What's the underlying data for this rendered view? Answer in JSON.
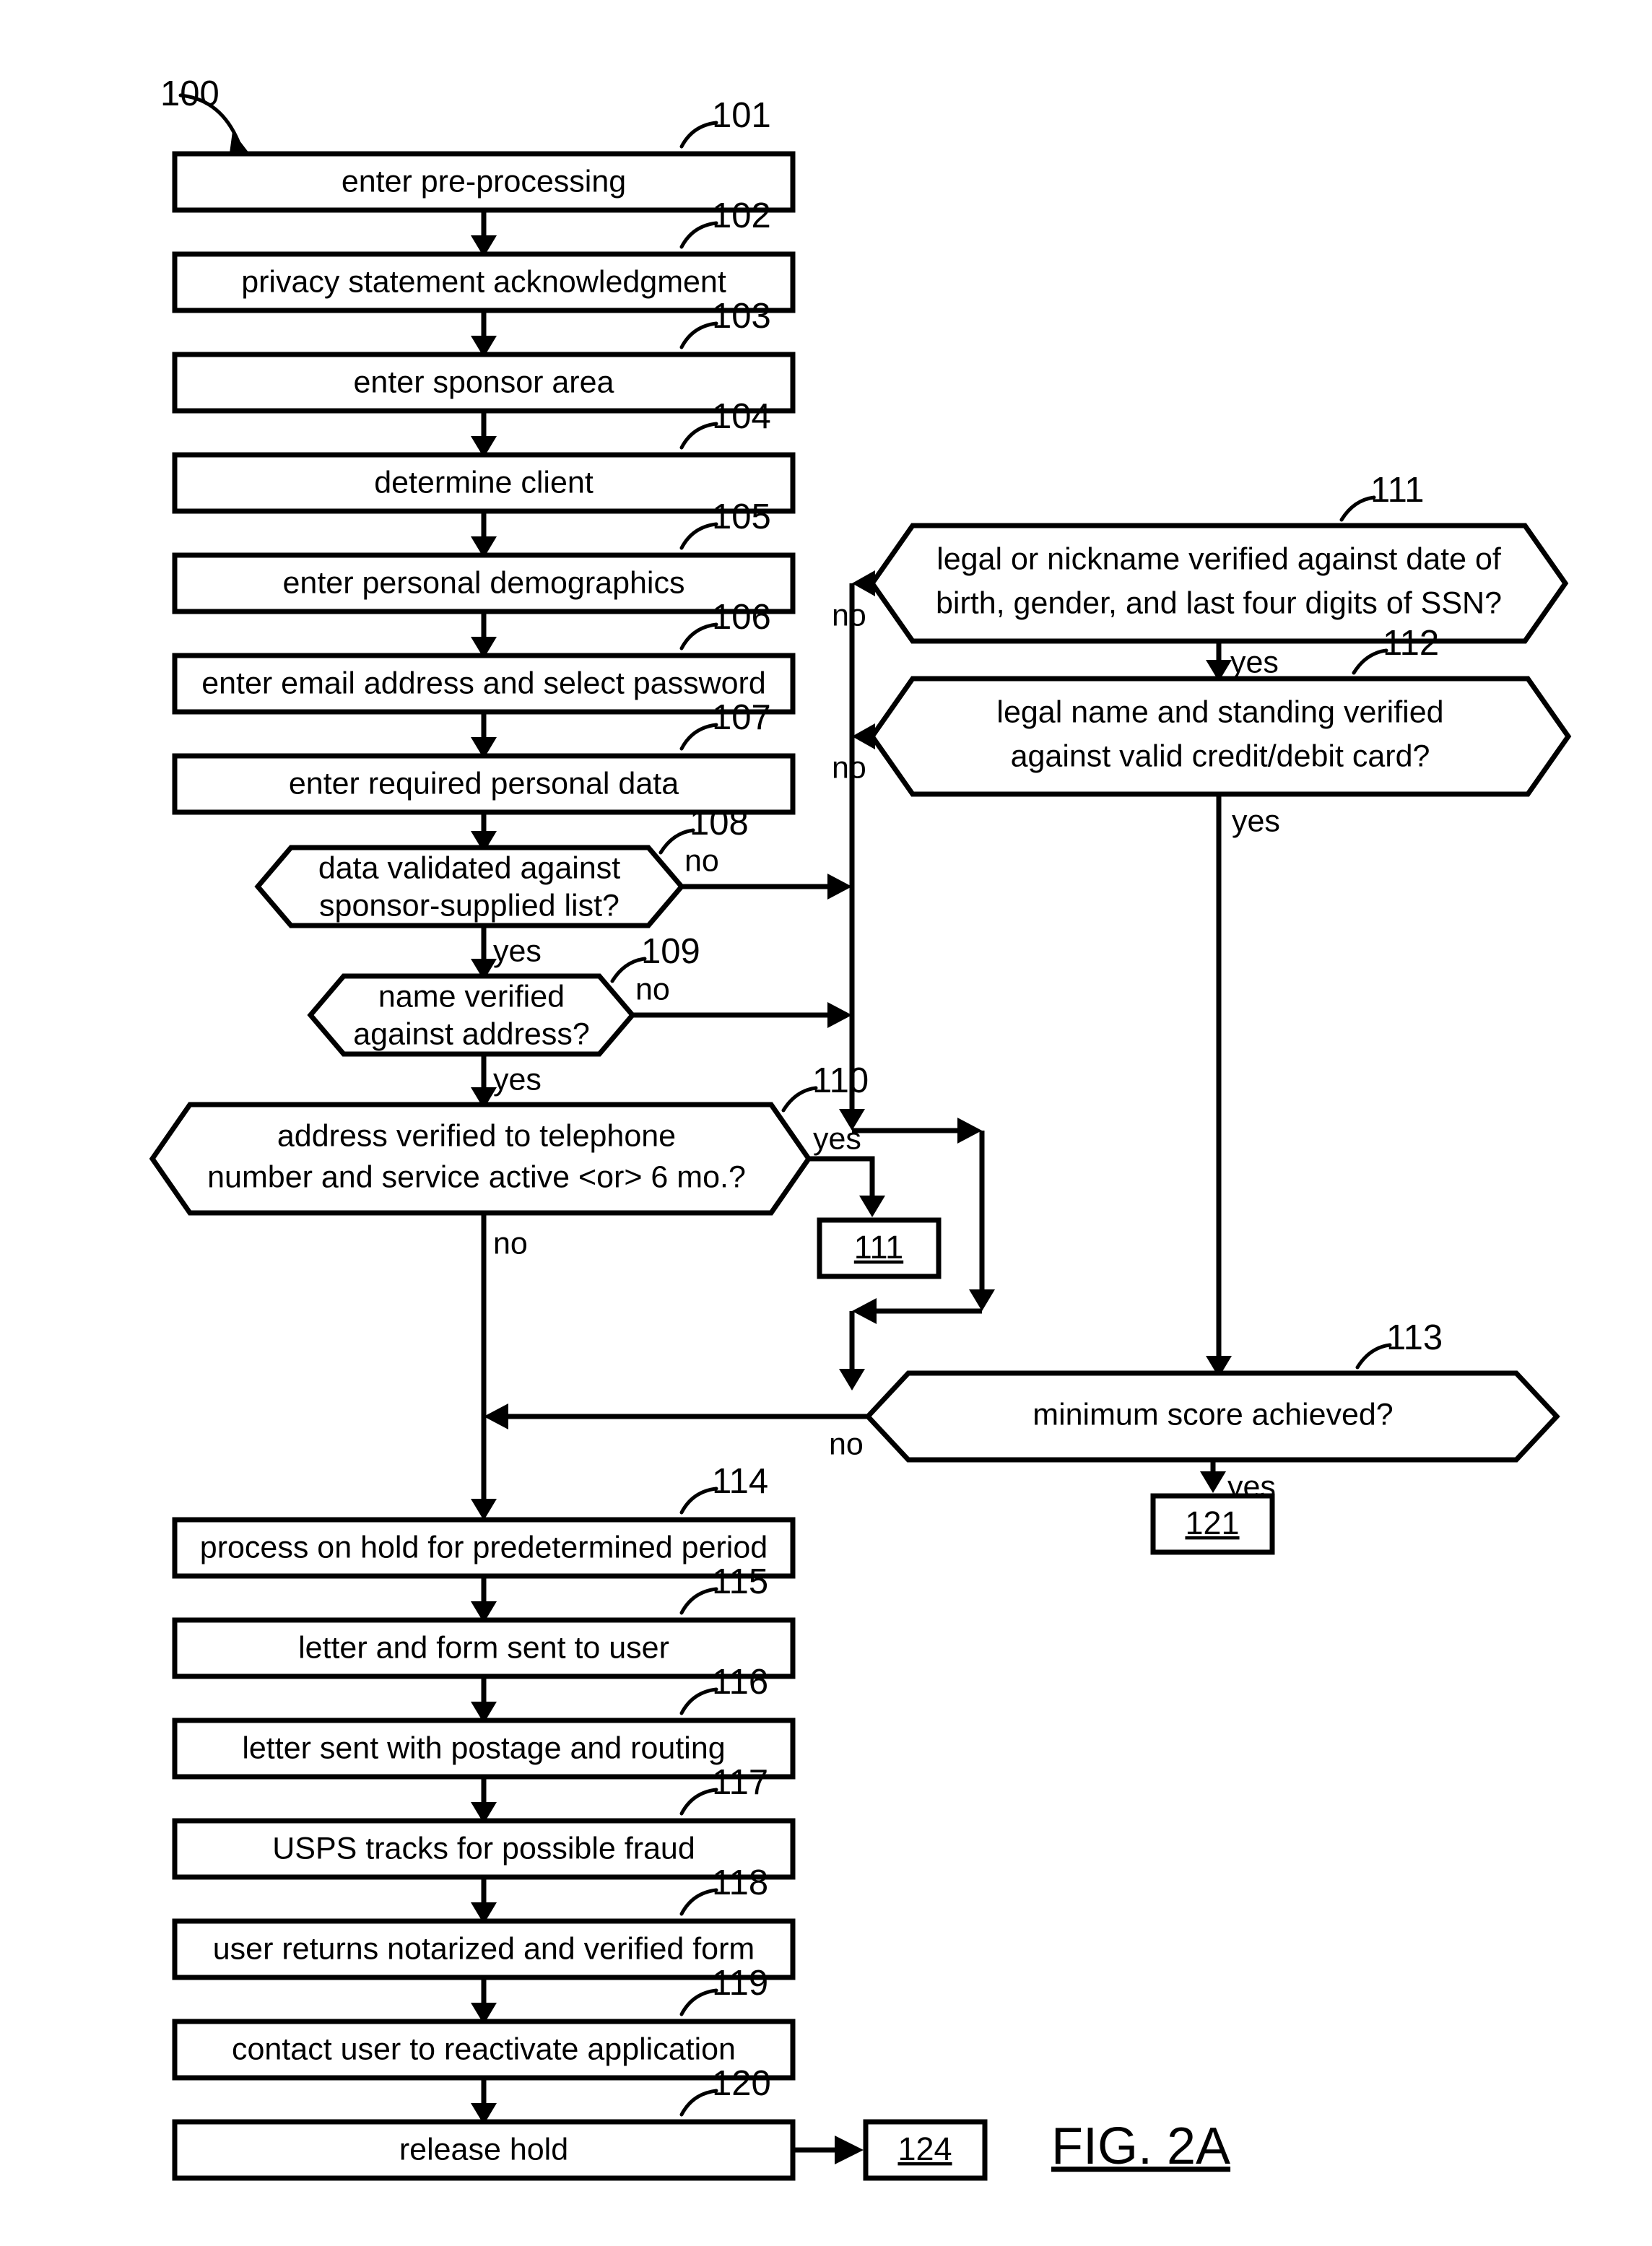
{
  "figure": {
    "label": "FIG. 2A",
    "process_ref": "100"
  },
  "nodes": [
    {
      "id": "101",
      "type": "process",
      "text": "enter pre-processing"
    },
    {
      "id": "102",
      "type": "process",
      "text": "privacy statement acknowledgment"
    },
    {
      "id": "103",
      "type": "process",
      "text": "enter sponsor area"
    },
    {
      "id": "104",
      "type": "process",
      "text": "determine client"
    },
    {
      "id": "105",
      "type": "process",
      "text": "enter personal demographics"
    },
    {
      "id": "106",
      "type": "process",
      "text": "enter email address and select password"
    },
    {
      "id": "107",
      "type": "process",
      "text": "enter required personal data"
    },
    {
      "id": "108",
      "type": "decision",
      "line1": "data validated against",
      "line2": "sponsor-supplied list?"
    },
    {
      "id": "109",
      "type": "decision",
      "line1": "name verified",
      "line2": "against address?"
    },
    {
      "id": "110",
      "type": "decision",
      "line1": "address verified to telephone",
      "line2": "number and service active <or> 6 mo.?"
    },
    {
      "id": "111",
      "type": "decision",
      "line1": "legal or nickname verified against date of",
      "line2": "birth, gender, and last four digits of SSN?"
    },
    {
      "id": "112",
      "type": "decision",
      "line1": "legal name and standing verified",
      "line2": "against valid credit/debit card?"
    },
    {
      "id": "113",
      "type": "decision",
      "line1": "minimum score achieved?",
      "line2": ""
    },
    {
      "id": "114",
      "type": "process",
      "text": "process on hold for predetermined period"
    },
    {
      "id": "115",
      "type": "process",
      "text": "letter and form sent to user"
    },
    {
      "id": "116",
      "type": "process",
      "text": "letter sent with postage and routing"
    },
    {
      "id": "117",
      "type": "process",
      "text": "USPS tracks for possible fraud"
    },
    {
      "id": "118",
      "type": "process",
      "text": "user returns notarized and verified form"
    },
    {
      "id": "119",
      "type": "process",
      "text": "contact user to reactivate application"
    },
    {
      "id": "120",
      "type": "process",
      "text": "release hold"
    }
  ],
  "connectors": [
    {
      "id": "conn-111",
      "text": "111"
    },
    {
      "id": "conn-121",
      "text": "121"
    },
    {
      "id": "conn-124",
      "text": "124"
    }
  ],
  "branch_labels": {
    "d108_no": "no",
    "d108_yes": "yes",
    "d109_no": "no",
    "d109_yes": "yes",
    "d110_yes": "yes",
    "d110_no": "no",
    "d111_no": "no",
    "d111_yes": "yes",
    "d112_no": "no",
    "d112_yes": "yes",
    "d113_no": "no",
    "d113_yes": "yes"
  },
  "colors": {
    "stroke": "#000000",
    "fill": "#ffffff"
  }
}
